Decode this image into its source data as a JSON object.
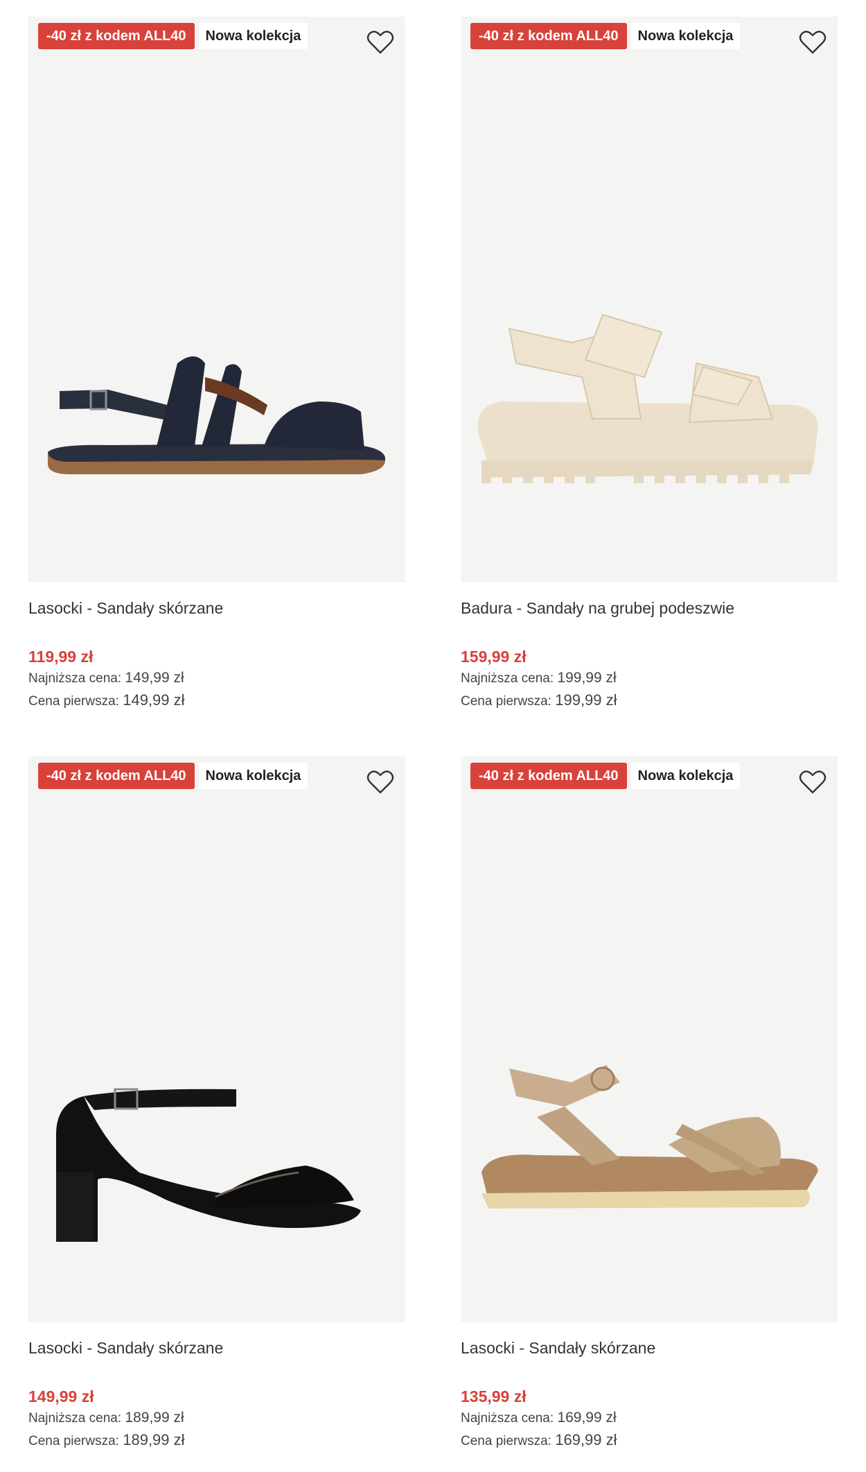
{
  "colors": {
    "accent": "#d9413b",
    "image_bg": "#f4f4f3"
  },
  "products": [
    {
      "promo_badge": "-40 zł z kodem ALL40",
      "new_badge": "Nowa kolekcja",
      "title": "Lasocki - Sandały skórzane",
      "price": "119,99 zł",
      "lowest_label": "Najniższa cena:",
      "lowest_value": "149,99 zł",
      "first_label": "Cena pierwsza:",
      "first_value": "149,99 zł",
      "icon": "heart-icon"
    },
    {
      "promo_badge": "-40 zł z kodem ALL40",
      "new_badge": "Nowa kolekcja",
      "title": "Badura - Sandały na grubej podeszwie",
      "price": "159,99 zł",
      "lowest_label": "Najniższa cena:",
      "lowest_value": "199,99 zł",
      "first_label": "Cena pierwsza:",
      "first_value": "199,99 zł",
      "icon": "heart-icon"
    },
    {
      "promo_badge": "-40 zł z kodem ALL40",
      "new_badge": "Nowa kolekcja",
      "title": "Lasocki - Sandały skórzane",
      "price": "149,99 zł",
      "lowest_label": "Najniższa cena:",
      "lowest_value": "189,99 zł",
      "first_label": "Cena pierwsza:",
      "first_value": "189,99 zł",
      "icon": "heart-icon"
    },
    {
      "promo_badge": "-40 zł z kodem ALL40",
      "new_badge": "Nowa kolekcja",
      "title": "Lasocki - Sandały skórzane",
      "price": "135,99 zł",
      "lowest_label": "Najniższa cena:",
      "lowest_value": "169,99 zł",
      "first_label": "Cena pierwsza:",
      "first_value": "169,99 zł",
      "icon": "heart-icon"
    }
  ]
}
